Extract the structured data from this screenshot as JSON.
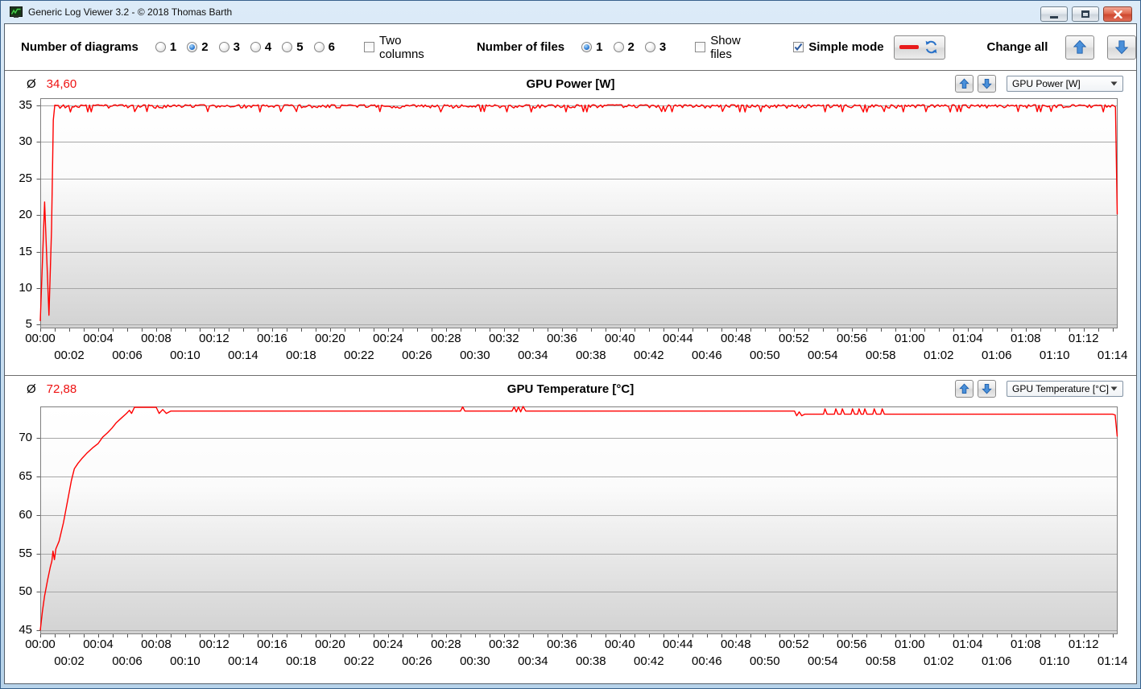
{
  "window": {
    "title": "Generic Log Viewer 3.2 - © 2018 Thomas Barth"
  },
  "icons": [
    "app-logo-icon",
    "minimize-icon",
    "maximize-icon",
    "close-icon",
    "line-sample-icon",
    "refresh-icon",
    "arrow-up-icon",
    "arrow-down-icon",
    "dropdown-arrow-icon",
    "check-icon",
    "radio-dot-icon"
  ],
  "colors": {
    "series_red": "#ff0000",
    "average_value_red": "#ee1111",
    "arrow_blue": "#4a90da",
    "titlebar_blue": "#c9ddf0",
    "plot_gradient_bottom": "#d2d2d2"
  },
  "toolbar": {
    "diagrams_label": "Number of diagrams",
    "diagram_options": [
      "1",
      "2",
      "3",
      "4",
      "5",
      "6"
    ],
    "diagram_selected": "2",
    "two_columns_label": "Two columns",
    "two_columns_checked": false,
    "files_label": "Number of files",
    "file_options": [
      "1",
      "2",
      "3"
    ],
    "file_selected": "1",
    "show_files_label": "Show files",
    "show_files_checked": false,
    "simple_mode_label": "Simple mode",
    "simple_mode_checked": true,
    "change_all_label": "Change all"
  },
  "chart_data": [
    {
      "type": "line",
      "title": "GPU Power [W]",
      "average_symbol": "Ø",
      "average": "34,60",
      "selector_value": "GPU Power [W]",
      "line_color": "#ff0000",
      "legend_position": "none",
      "grid": true,
      "x_axis": {
        "min": 0,
        "max": 74.35,
        "minor_tick_min": 1,
        "label_every_min": 2,
        "labels": [
          "00:00",
          "00:02",
          "00:04",
          "00:06",
          "00:08",
          "00:10",
          "00:12",
          "00:14",
          "00:16",
          "00:18",
          "00:20",
          "00:22",
          "00:24",
          "00:26",
          "00:28",
          "00:30",
          "00:32",
          "00:34",
          "00:36",
          "00:38",
          "00:40",
          "00:42",
          "00:44",
          "00:46",
          "00:48",
          "00:50",
          "00:52",
          "00:54",
          "00:56",
          "00:58",
          "01:00",
          "01:02",
          "01:04",
          "01:06",
          "01:08",
          "01:10",
          "01:12",
          "01:14"
        ]
      },
      "y_axis": {
        "min": 4.5,
        "max": 36,
        "ticks": [
          35,
          30,
          25,
          20,
          15,
          10,
          5
        ]
      },
      "series": {
        "name": "GPU Power",
        "segments": [
          {
            "points": [
              [
                0,
                5.5
              ],
              [
                0.3,
                21.8
              ],
              [
                0.6,
                6.3
              ],
              [
                0.78,
                18
              ],
              [
                0.9,
                33
              ],
              [
                1.0,
                35
              ]
            ]
          },
          {
            "noise": {
              "from": 1.0,
              "to": 74.05,
              "base": 35,
              "amp": 0.55,
              "step": 0.12
            }
          },
          {
            "points": [
              [
                74.05,
                35
              ],
              [
                74.2,
                34.8
              ],
              [
                74.32,
                20.1
              ]
            ]
          }
        ]
      }
    },
    {
      "type": "line",
      "title": "GPU Temperature [°C]",
      "average_symbol": "Ø",
      "average": "72,88",
      "selector_value": "GPU Temperature [°C]",
      "line_color": "#ff0000",
      "legend_position": "none",
      "grid": true,
      "x_axis": {
        "min": 0,
        "max": 74.35,
        "minor_tick_min": 1,
        "label_every_min": 2,
        "labels": [
          "00:00",
          "00:02",
          "00:04",
          "00:06",
          "00:08",
          "00:10",
          "00:12",
          "00:14",
          "00:16",
          "00:18",
          "00:20",
          "00:22",
          "00:24",
          "00:26",
          "00:28",
          "00:30",
          "00:32",
          "00:34",
          "00:36",
          "00:38",
          "00:40",
          "00:42",
          "00:44",
          "00:46",
          "00:48",
          "00:50",
          "00:52",
          "00:54",
          "00:56",
          "00:58",
          "01:00",
          "01:02",
          "01:04",
          "01:06",
          "01:08",
          "01:10",
          "01:12",
          "01:14"
        ]
      },
      "y_axis": {
        "min": 44.5,
        "max": 74.1,
        "ticks": [
          70,
          65,
          60,
          55,
          50,
          45
        ]
      },
      "series": {
        "name": "GPU Temperature",
        "segments": [
          {
            "points": [
              [
                0,
                45
              ],
              [
                0.15,
                47.5
              ],
              [
                0.3,
                49.5
              ],
              [
                0.5,
                51.5
              ],
              [
                0.7,
                53.3
              ],
              [
                0.8,
                54.0
              ],
              [
                0.88,
                55.3
              ],
              [
                0.98,
                54.2
              ],
              [
                1.08,
                55.6
              ],
              [
                1.3,
                56.6
              ],
              [
                1.6,
                59.0
              ],
              [
                1.9,
                62.0
              ],
              [
                2.15,
                64.5
              ],
              [
                2.35,
                66.0
              ],
              [
                2.6,
                66.7
              ],
              [
                2.9,
                67.4
              ],
              [
                3.2,
                68.0
              ],
              [
                3.6,
                68.7
              ],
              [
                4.0,
                69.3
              ],
              [
                4.3,
                70.1
              ],
              [
                4.65,
                70.7
              ],
              [
                4.95,
                71.3
              ],
              [
                5.25,
                72.0
              ],
              [
                5.6,
                72.6
              ],
              [
                5.95,
                73.2
              ],
              [
                6.15,
                73.6
              ],
              [
                6.3,
                73.2
              ],
              [
                6.5,
                74.0
              ],
              [
                8.0,
                74.0
              ],
              [
                8.2,
                73.2
              ],
              [
                8.45,
                73.7
              ],
              [
                8.7,
                73.2
              ],
              [
                9.0,
                73.5
              ],
              [
                29.0,
                73.5
              ],
              [
                29.15,
                74.05
              ],
              [
                29.3,
                73.5
              ],
              [
                32.55,
                73.5
              ],
              [
                32.7,
                74.05
              ],
              [
                32.85,
                73.4
              ],
              [
                33.0,
                74.05
              ],
              [
                33.15,
                73.4
              ],
              [
                33.32,
                74.1
              ],
              [
                33.5,
                73.5
              ],
              [
                52.05,
                73.5
              ],
              [
                52.2,
                72.9
              ],
              [
                52.38,
                73.4
              ],
              [
                52.55,
                72.9
              ],
              [
                52.75,
                73.1
              ],
              [
                54.05,
                73.1
              ],
              [
                54.15,
                73.8
              ],
              [
                54.3,
                73.1
              ],
              [
                54.8,
                73.1
              ],
              [
                54.9,
                73.8
              ],
              [
                55.05,
                73.1
              ],
              [
                55.25,
                73.1
              ],
              [
                55.35,
                73.8
              ],
              [
                55.5,
                73.1
              ],
              [
                55.95,
                73.1
              ],
              [
                56.05,
                73.8
              ],
              [
                56.2,
                73.1
              ],
              [
                56.4,
                73.1
              ],
              [
                56.5,
                73.8
              ],
              [
                56.65,
                73.1
              ],
              [
                56.8,
                73.1
              ],
              [
                56.9,
                73.8
              ],
              [
                57.05,
                73.1
              ],
              [
                57.45,
                73.1
              ],
              [
                57.55,
                73.8
              ],
              [
                57.7,
                73.1
              ],
              [
                58.0,
                73.1
              ],
              [
                58.1,
                73.8
              ],
              [
                58.25,
                73.1
              ],
              [
                74.0,
                73.1
              ],
              [
                74.18,
                73.0
              ],
              [
                74.32,
                70.2
              ]
            ]
          }
        ]
      }
    }
  ]
}
